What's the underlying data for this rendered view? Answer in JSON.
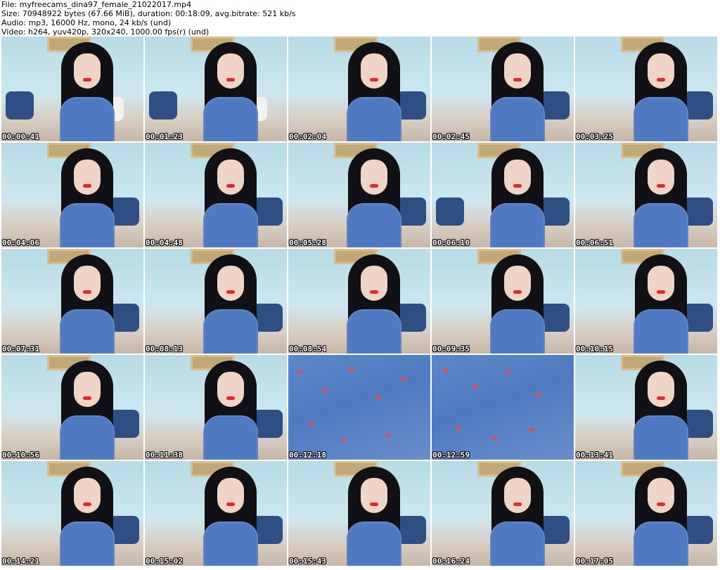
{
  "header": {
    "file": "File: myfreecams_dina97_female_21022017.mp4",
    "size": "Size: 70948922 bytes (67.66 MiB), duration: 00:18:09, avg.bitrate: 521 kb/s",
    "audio": "Audio: mp3, 16000 Hz, mono, 24 kb/s (und)",
    "video": "Video: h264, yuv420p, 320x240, 1000.00 fps(r) (und)"
  },
  "thumbnails": [
    {
      "timestamp": "00:00:41"
    },
    {
      "timestamp": "00:01:23"
    },
    {
      "timestamp": "00:02:04"
    },
    {
      "timestamp": "00:02:45"
    },
    {
      "timestamp": "00:03:25"
    },
    {
      "timestamp": "00:04:06"
    },
    {
      "timestamp": "00:04:48"
    },
    {
      "timestamp": "00:05:28"
    },
    {
      "timestamp": "00:06:10"
    },
    {
      "timestamp": "00:06:51"
    },
    {
      "timestamp": "00:07:31"
    },
    {
      "timestamp": "00:08:13"
    },
    {
      "timestamp": "00:08:54"
    },
    {
      "timestamp": "00:09:35"
    },
    {
      "timestamp": "00:10:15"
    },
    {
      "timestamp": "00:10:56"
    },
    {
      "timestamp": "00:11:38"
    },
    {
      "timestamp": "00:12:18"
    },
    {
      "timestamp": "00:12:59"
    },
    {
      "timestamp": "00:13:41"
    },
    {
      "timestamp": "00:14:21"
    },
    {
      "timestamp": "00:15:02"
    },
    {
      "timestamp": "00:15:43"
    },
    {
      "timestamp": "00:16:24"
    },
    {
      "timestamp": "00:17:05"
    }
  ]
}
